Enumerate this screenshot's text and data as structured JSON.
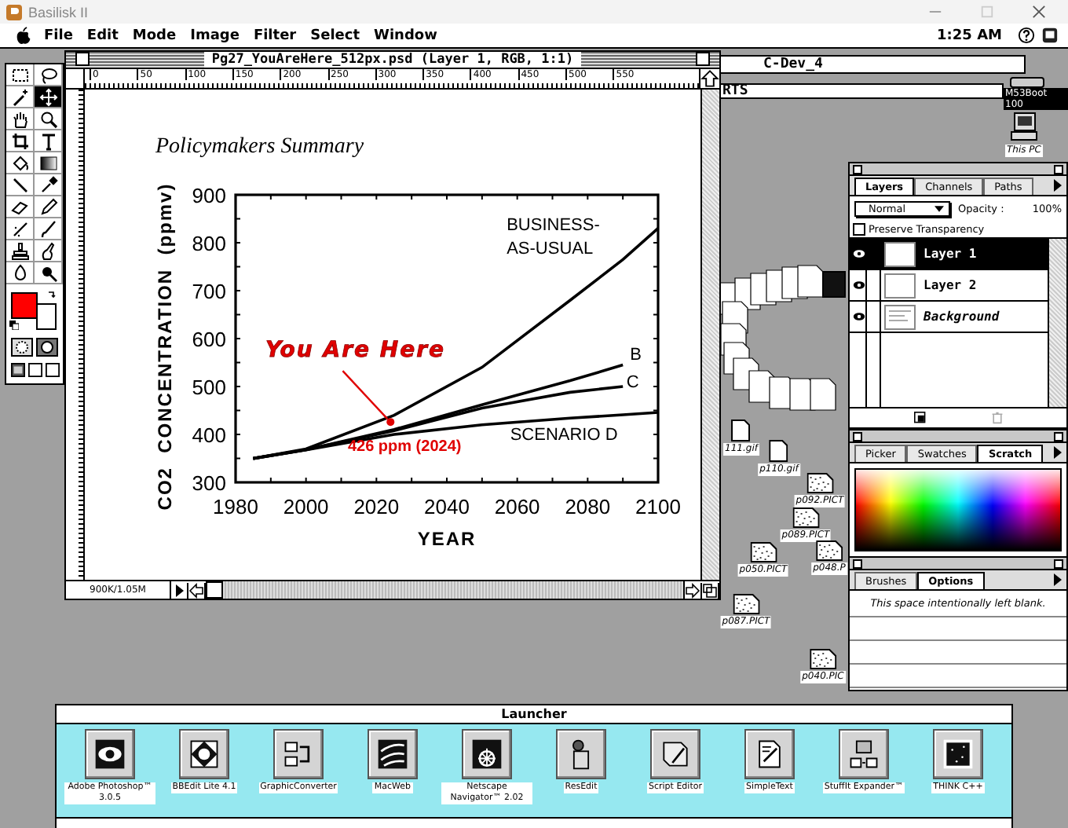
{
  "host_window": {
    "title": "Basilisk II"
  },
  "menu_bar": {
    "items": [
      "File",
      "Edit",
      "Mode",
      "Image",
      "Filter",
      "Select",
      "Window"
    ],
    "clock": "1:25 AM"
  },
  "tools": [
    {
      "selected": false
    },
    {
      "selected": false
    },
    {
      "selected": false
    },
    {
      "selected": true
    },
    {
      "selected": false
    },
    {
      "selected": false
    },
    {
      "selected": false
    },
    {
      "selected": false
    },
    {
      "selected": false
    },
    {
      "selected": false
    },
    {
      "selected": false
    },
    {
      "selected": false
    },
    {
      "selected": false
    },
    {
      "selected": false
    },
    {
      "selected": false
    },
    {
      "selected": false
    },
    {
      "selected": false
    },
    {
      "selected": false
    },
    {
      "selected": false
    },
    {
      "selected": false
    }
  ],
  "document": {
    "title": "Pg27_YouAreHere_512px.psd (Layer 1, RGB, 1:1)",
    "ruler_marks": [
      "0",
      "50",
      "100",
      "150",
      "200",
      "250",
      "300",
      "350",
      "400",
      "450",
      "500",
      "550"
    ],
    "heading": "Policymakers Summary",
    "chart_data": {
      "type": "line",
      "xlabel": "YEAR",
      "ylabel": "CO2  CONCENTRATION  (ppmv)",
      "x": [
        1985,
        2000,
        2025,
        2050,
        2075,
        2090,
        2100
      ],
      "series": [
        {
          "name": "BUSINESS-AS-USUAL",
          "color": "#000000",
          "values": [
            350,
            370,
            440,
            540,
            680,
            765,
            830
          ]
        },
        {
          "name": "B",
          "color": "#000000",
          "values": [
            350,
            368,
            410,
            462,
            512,
            545,
            null
          ]
        },
        {
          "name": "C",
          "color": "#000000",
          "values": [
            350,
            368,
            408,
            455,
            488,
            500,
            null
          ]
        },
        {
          "name": "SCENARIO D",
          "color": "#000000",
          "values": [
            350,
            368,
            400,
            420,
            434,
            441,
            446
          ]
        }
      ],
      "legend": "right",
      "xlim": [
        1980,
        2100
      ],
      "ylim": [
        300,
        900
      ],
      "xticks": [
        1980,
        2000,
        2020,
        2040,
        2060,
        2080,
        2100
      ],
      "yticks": [
        300,
        400,
        500,
        600,
        700,
        800,
        900
      ],
      "annotations": [
        "You Are Here",
        "426 ppm (2024)"
      ]
    },
    "status": "900K/1.05M"
  },
  "background_windows": [
    {
      "title": "C-Dev_4"
    },
    {
      "title": "RTS"
    }
  ],
  "desktop_text": "M53Boot 100",
  "desktop_icons": [
    {
      "label": "This PC",
      "kind": "computer"
    },
    {
      "label": "111.gif",
      "kind": "file"
    },
    {
      "label": "p110.gif",
      "kind": "file"
    },
    {
      "label": "p092.PICT",
      "kind": "image"
    },
    {
      "label": "p089.PICT",
      "kind": "image"
    },
    {
      "label": "p050.PICT",
      "kind": "image"
    },
    {
      "label": "p048.P",
      "kind": "image"
    },
    {
      "label": "p087.PICT",
      "kind": "image"
    },
    {
      "label": "p040.PIC",
      "kind": "image"
    }
  ],
  "layers_palette": {
    "tabs": [
      {
        "label": "Layers",
        "selected": true
      },
      {
        "label": "Channels",
        "selected": false
      },
      {
        "label": "Paths",
        "selected": false
      }
    ],
    "blend_mode": "Normal",
    "opacity_label": "Opacity :",
    "opacity": "100%",
    "preserve_transparency_label": "Preserve Transparency",
    "preserve_transparency": false,
    "layers": [
      {
        "name": "Layer 1",
        "selected": true,
        "visible": true,
        "kind": "layer"
      },
      {
        "name": "Layer 2",
        "selected": false,
        "visible": true,
        "kind": "layer"
      },
      {
        "name": "Background",
        "selected": false,
        "visible": true,
        "kind": "background"
      }
    ]
  },
  "color_palette": {
    "tabs": [
      {
        "label": "Picker",
        "selected": false
      },
      {
        "label": "Swatches",
        "selected": false
      },
      {
        "label": "Scratch",
        "selected": true
      }
    ]
  },
  "options_palette": {
    "tabs": [
      {
        "label": "Brushes",
        "selected": false
      },
      {
        "label": "Options",
        "selected": true
      }
    ],
    "message": "This space intentionally left blank."
  },
  "launcher": {
    "title": "Launcher",
    "apps": [
      {
        "label": "Adobe Photoshop™ 3.0.5"
      },
      {
        "label": "BBEdit Lite 4.1"
      },
      {
        "label": "GraphicConverter"
      },
      {
        "label": "MacWeb"
      },
      {
        "label": "Netscape Navigator™ 2.02"
      },
      {
        "label": "ResEdit"
      },
      {
        "label": "Script Editor"
      },
      {
        "label": "SimpleText"
      },
      {
        "label": "StuffIt Expander™"
      },
      {
        "label": "THINK C++"
      }
    ]
  }
}
